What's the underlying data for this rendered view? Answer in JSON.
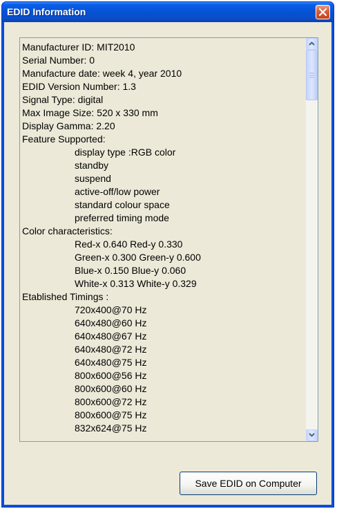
{
  "window": {
    "title": "EDID Information",
    "close_icon": "close-icon"
  },
  "edid": {
    "lines": [
      {
        "text": "Manufacturer ID: MIT2010",
        "indent": false
      },
      {
        "text": "Serial Number: 0",
        "indent": false
      },
      {
        "text": "Manufacture date: week 4, year 2010",
        "indent": false
      },
      {
        "text": "EDID Version Number: 1.3",
        "indent": false
      },
      {
        "text": "Signal Type: digital",
        "indent": false
      },
      {
        "text": "Max Image Size: 520 x 330 mm",
        "indent": false
      },
      {
        "text": "Display Gamma: 2.20",
        "indent": false
      },
      {
        "text": "Feature Supported:",
        "indent": false
      },
      {
        "text": "display type :RGB color",
        "indent": true
      },
      {
        "text": "standby",
        "indent": true
      },
      {
        "text": "suspend",
        "indent": true
      },
      {
        "text": "active-off/low power",
        "indent": true
      },
      {
        "text": "standard colour space",
        "indent": true
      },
      {
        "text": "preferred timing mode",
        "indent": true
      },
      {
        "text": "Color characteristics:",
        "indent": false
      },
      {
        "text": "Red-x 0.640  Red-y 0.330",
        "indent": true
      },
      {
        "text": "Green-x 0.300  Green-y 0.600",
        "indent": true
      },
      {
        "text": "Blue-x 0.150  Blue-y 0.060",
        "indent": true
      },
      {
        "text": "White-x 0.313  White-y 0.329",
        "indent": true
      },
      {
        "text": "Etablished Timings :",
        "indent": false
      },
      {
        "text": "720x400@70 Hz",
        "indent": true
      },
      {
        "text": "640x480@60 Hz",
        "indent": true
      },
      {
        "text": "640x480@67 Hz",
        "indent": true
      },
      {
        "text": "640x480@72 Hz",
        "indent": true
      },
      {
        "text": "640x480@75 Hz",
        "indent": true
      },
      {
        "text": "800x600@56 Hz",
        "indent": true
      },
      {
        "text": "800x600@60 Hz",
        "indent": true
      },
      {
        "text": "800x600@72 Hz",
        "indent": true
      },
      {
        "text": "800x600@75 Hz",
        "indent": true
      },
      {
        "text": "832x624@75 Hz",
        "indent": true
      }
    ]
  },
  "scrollbar": {
    "up_icon": "chevron-up-icon",
    "down_icon": "chevron-down-icon",
    "position": 0
  },
  "buttons": {
    "save_label": "Save EDID on Computer"
  },
  "colors": {
    "titlebar": "#0552d4",
    "face": "#ece9d8",
    "close": "#d8613e"
  }
}
